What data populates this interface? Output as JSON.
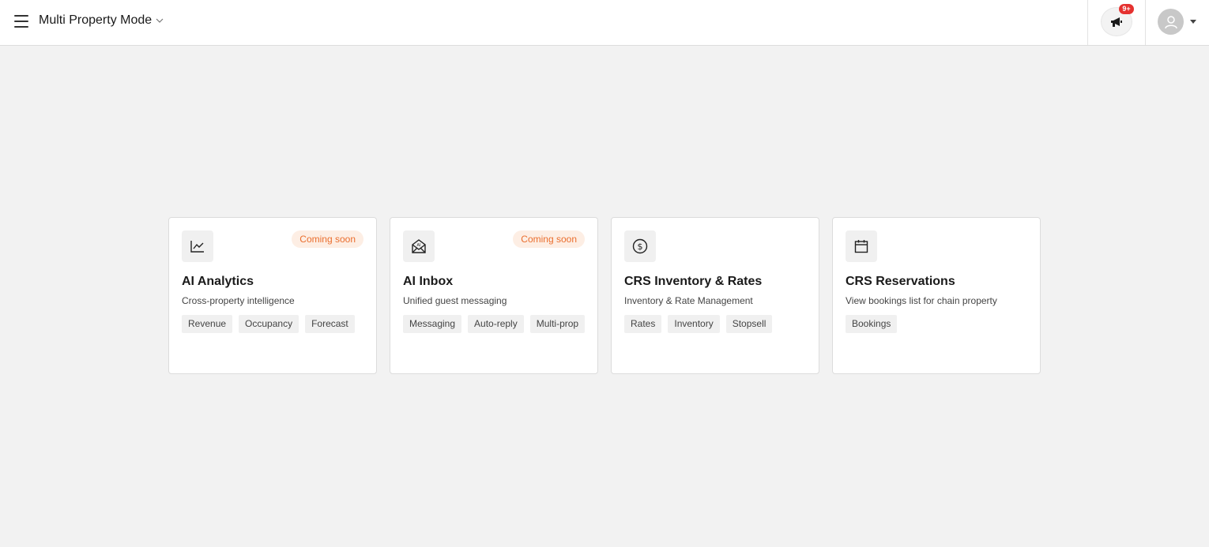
{
  "header": {
    "title": "Multi Property Mode",
    "menu_icon": "hamburger-menu-icon",
    "dropdown_icon": "chevron-down-icon",
    "notification_badge": "9+",
    "notification_icon": "megaphone-icon",
    "avatar_icon": "user-avatar-icon"
  },
  "cards": [
    {
      "title": "AI Analytics",
      "description": "Cross-property intelligence",
      "badge": "Coming soon",
      "icon": "line-chart-icon",
      "tags": [
        "Revenue",
        "Occupancy",
        "Forecast"
      ]
    },
    {
      "title": "AI Inbox",
      "description": "Unified guest messaging",
      "badge": "Coming soon",
      "icon": "ai-mail-icon",
      "tags": [
        "Messaging",
        "Auto-reply",
        "Multi-prop"
      ]
    },
    {
      "title": "CRS Inventory & Rates",
      "description": "Inventory & Rate Management",
      "badge": "",
      "icon": "dollar-circle-icon",
      "tags": [
        "Rates",
        "Inventory",
        "Stopsell"
      ]
    },
    {
      "title": "CRS Reservations",
      "description": "View bookings list for chain property",
      "badge": "",
      "icon": "calendar-icon",
      "tags": [
        "Bookings"
      ]
    }
  ],
  "colors": {
    "background": "#f2f2f2",
    "badge_text": "#ea6e2e",
    "badge_bg": "#fdeee4",
    "notification_badge": "#e5312f"
  }
}
